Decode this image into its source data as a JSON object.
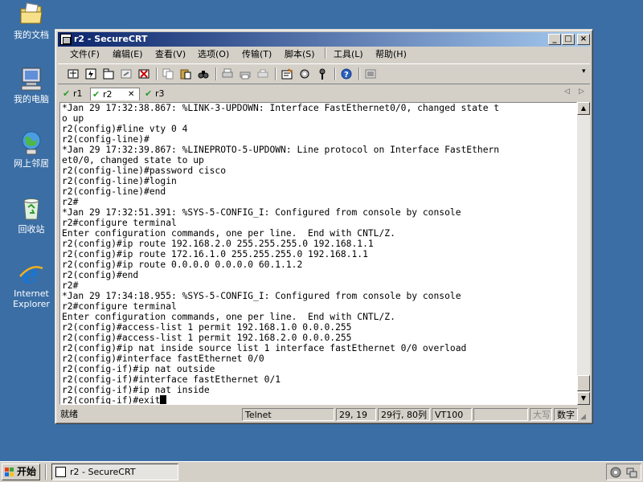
{
  "desktop": {
    "icons": [
      {
        "name": "my-documents",
        "label": "我的文档"
      },
      {
        "name": "my-computer",
        "label": "我的电脑"
      },
      {
        "name": "network-places",
        "label": "网上邻居"
      },
      {
        "name": "recycle-bin",
        "label": "回收站"
      },
      {
        "name": "internet-explorer",
        "label": "Internet Explorer"
      }
    ]
  },
  "window": {
    "title": "r2 - SecureCRT",
    "menu": [
      "文件(F)",
      "编辑(E)",
      "查看(V)",
      "选项(O)",
      "传输(T)",
      "脚本(S)",
      "工具(L)",
      "帮助(H)"
    ],
    "toolbar_icons": [
      "connect-icon",
      "quick-connect-icon",
      "connect-tab-icon",
      "reconnect-icon",
      "disconnect-icon",
      "copy-icon",
      "paste-icon",
      "find-icon",
      "print-icon",
      "print-selection-icon",
      "print-setup-icon",
      "session-options-icon",
      "global-options-icon",
      "keymap-icon",
      "help-icon",
      "screenshot-icon"
    ],
    "tabs": [
      {
        "label": "r1",
        "active": false
      },
      {
        "label": "r2",
        "active": true
      },
      {
        "label": "r3",
        "active": false
      }
    ],
    "tab_close_glyph": "✕",
    "terminal_lines": [
      "*Jan 29 17:32:38.867: %LINK-3-UPDOWN: Interface FastEthernet0/0, changed state t",
      "o up",
      "r2(config)#line vty 0 4",
      "r2(config-line)#",
      "*Jan 29 17:32:39.867: %LINEPROTO-5-UPDOWN: Line protocol on Interface FastEthern",
      "et0/0, changed state to up",
      "r2(config-line)#password cisco",
      "r2(config-line)#login",
      "r2(config-line)#end",
      "r2#",
      "*Jan 29 17:32:51.391: %SYS-5-CONFIG_I: Configured from console by console",
      "r2#configure terminal",
      "Enter configuration commands, one per line.  End with CNTL/Z.",
      "r2(config)#ip route 192.168.2.0 255.255.255.0 192.168.1.1",
      "r2(config)#ip route 172.16.1.0 255.255.255.0 192.168.1.1",
      "r2(config)#ip route 0.0.0.0 0.0.0.0 60.1.1.2",
      "r2(config)#end",
      "r2#",
      "*Jan 29 17:34:18.955: %SYS-5-CONFIG_I: Configured from console by console",
      "r2#configure terminal",
      "Enter configuration commands, one per line.  End with CNTL/Z.",
      "r2(config)#access-list 1 permit 192.168.1.0 0.0.0.255",
      "r2(config)#access-list 1 permit 192.168.2.0 0.0.0.255",
      "r2(config)#ip nat inside source list 1 interface fastEthernet 0/0 overload",
      "r2(config)#interface fastEthernet 0/0",
      "r2(config-if)#ip nat outside",
      "r2(config-if)#interface fastEthernet 0/1",
      "r2(config-if)#ip nat inside",
      "r2(config-if)#exit"
    ],
    "status": {
      "ready": "就绪",
      "protocol": "Telnet",
      "cursor": "29, 19",
      "size": "29行, 80列",
      "emulation": "VT100",
      "blank": "",
      "caps": "大写",
      "num": "数字"
    }
  },
  "taskbar": {
    "start_label": "开始",
    "task_label": "r2 - SecureCRT"
  },
  "colors": {
    "desktop": "#3a6ea5",
    "title_start": "#0a246a",
    "title_end": "#a6caf0",
    "chrome": "#d4d0c8"
  }
}
